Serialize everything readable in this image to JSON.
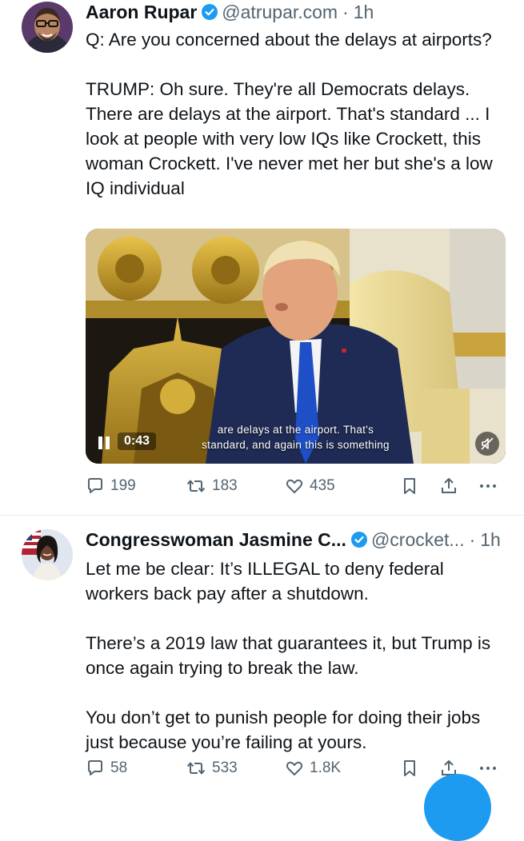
{
  "tweets": [
    {
      "author_name": "Aaron Rupar",
      "handle": "@atrupar.com",
      "separator": "·",
      "time": "1h",
      "paragraphs": [
        "Q: Are you concerned about the delays at airports?",
        "TRUMP: Oh sure. They're all Democrats delays. There are delays at the airport. That's standard ... I look at people with very low IQs like Crockett, this woman Crockett. I've never met her but she's a low IQ individual"
      ],
      "video": {
        "caption_line1": "are delays at the airport. That's",
        "caption_line2": "standard, and again this is something",
        "elapsed": "0:43",
        "state_icon": "pause-icon",
        "mute_icon": "muted-speaker-icon"
      },
      "replies": "199",
      "reposts": "183",
      "likes": "435"
    },
    {
      "author_name": "Congresswoman Jasmine C...",
      "handle": "@crocket...",
      "separator": "·",
      "time": "1h",
      "paragraphs": [
        "Let me be clear: It’s ILLEGAL to deny federal workers back pay after a shutdown.",
        "There’s a 2019 law that guarantees it, but Trump is once again trying to break the law.",
        "You don’t get to punish people for doing their jobs just because you’re failing at yours."
      ],
      "replies": "58",
      "reposts": "533",
      "likes": "1.8K"
    }
  ],
  "icons": {
    "verified": "verified-badge-icon",
    "reply": "reply-icon",
    "repost": "repost-icon",
    "like": "heart-icon",
    "bookmark": "bookmark-icon",
    "share": "share-icon",
    "more": "more-icon"
  },
  "colors": {
    "text_primary": "#0f1419",
    "text_secondary": "#536471",
    "verified_blue": "#1d9bf0",
    "divider": "#e6e9ec",
    "fab_blue": "#1d9bf0"
  }
}
